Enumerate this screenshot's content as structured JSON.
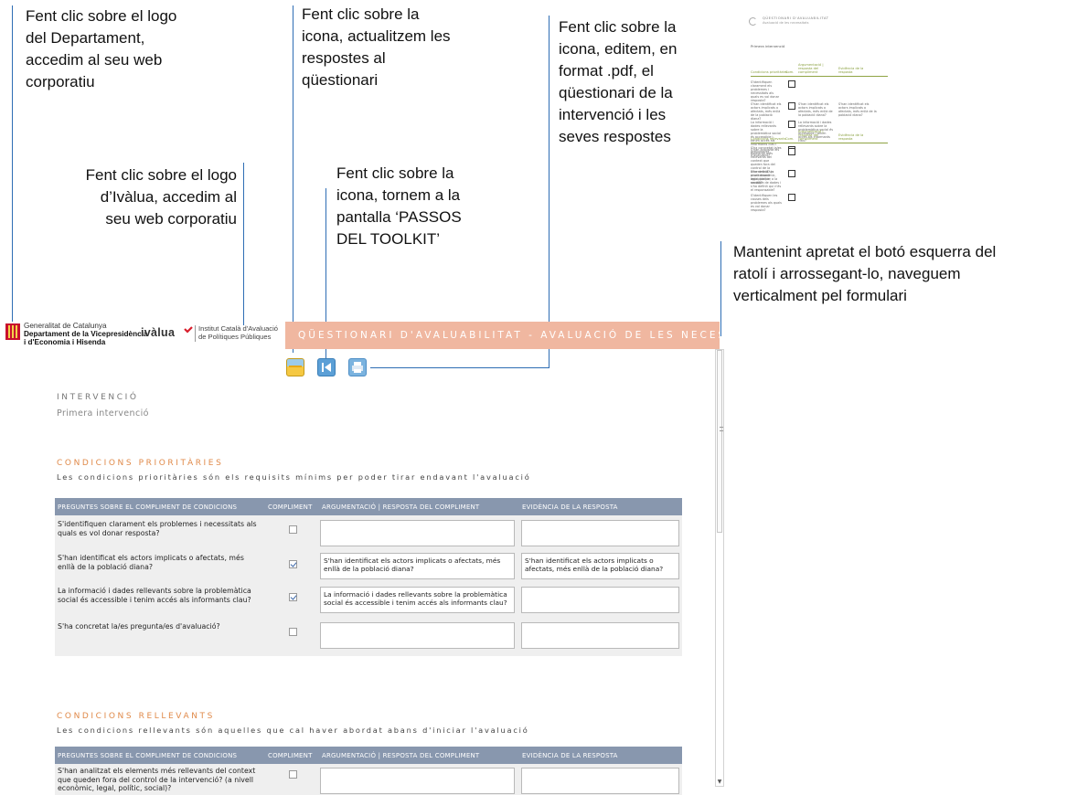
{
  "annotations": {
    "logo_departament": [
      "Fent clic sobre el logo",
      "del Departament,",
      "accedim al seu web",
      "corporatiu"
    ],
    "actualitzem": [
      "Fent clic sobre la",
      "icona, actualitzem les",
      "respostes al",
      "qüestionari"
    ],
    "editem": [
      "Fent clic sobre la",
      "icona, editem, en",
      "format .pdf, el",
      "qüestionari de la",
      "intervenció i les",
      "seves respostes"
    ],
    "logo_ivalua": [
      "Fent clic sobre el logo",
      "d’Ivàlua, accedim al",
      "seu web corporatiu"
    ],
    "tornem": [
      "Fent clic sobre la",
      "icona, tornem a la",
      "pantalla ‘PASSOS",
      "DEL TOOLKIT’"
    ],
    "scroll": [
      "Mantenint apretat el botó esquerra del",
      "ratolí i arrossegant-lo, naveguem",
      "verticalment pel formulari"
    ]
  },
  "thumbnail": {
    "title": "QÜESTIONARI D'AVALUABILITAT",
    "subtitle": "Avaluació de les necessitats",
    "intervention": "Primera intervenció",
    "h1": "Condicions prioritàries",
    "h_comp": "Com.",
    "h_arg": "Argumentació | resposta del compliment",
    "h_evid": "Evidència de la resposta",
    "h2": "Condicions rellevants",
    "rows1": [
      "S'identifiquen clarament els problemes i necessitats als quals es vol donar resposta?",
      "S'han identificat els actors implicats o afectats, més enllà de la població diana?",
      "La informació i dades rellevants sobre la problemàtica social és accessible i tenim accés als informants clau?",
      "S'ha concretat la/es pregunta/es d'avaluació?"
    ],
    "ans2": "S'han identificat els actors implicats o afectats, més enllà de la població diana?",
    "ans3": "La informació i dades rellevants sobre la problemàtica social és accessible i tenim accés als informants clau?",
    "rows2": [
      "S'han analitzat els elements més rellevants del context que queden fora del control de la intervenció? (a nivell econòmic, legal, polític, social)?",
      "S'ha definit un procediment aplicable per a la recollida de dades i s'ha definit qui n'és el responsable?",
      "S'identifiquen les causes dels problemes als quals es vol donar resposta?"
    ]
  },
  "header": {
    "generalitat_line1": "Generalitat de Catalunya",
    "generalitat_line2": "Departament de la Vicepresidència",
    "generalitat_line3": "i d'Economia i Hisenda",
    "ivalua": "ivàlua",
    "ivalua_inst_line1": "Institut Català d'Avaluació",
    "ivalua_inst_line2": "de Polítiques Públiques",
    "banner": "QÜESTIONARI D'AVALUABILITAT - AVALUACIÓ DE LES NECESSITATS"
  },
  "intervention": {
    "caption": "INTERVENCIÓ",
    "value": "Primera intervenció"
  },
  "table_headers": {
    "question": "PREGUNTES SOBRE EL COMPLIMENT DE CONDICIONS",
    "compliment": "COMPLIMENT",
    "argument": "ARGUMENTACIÓ | RESPOSTA DEL COMPLIMENT",
    "evidence": "EVIDÈNCIA DE LA RESPOSTA"
  },
  "prioritaries": {
    "title": "CONDICIONS PRIORITÀRIES",
    "desc": "Les condicions prioritàries són els requisits mínims per poder tirar endavant l'avaluació",
    "rows": [
      {
        "q": "S'identifiquen clarament els problemes i necessitats als quals es vol donar resposta?",
        "arg": "",
        "evid": ""
      },
      {
        "q": "S'han identificat els actors implicats o afectats, més enllà de la població diana?",
        "arg": "S'han identificat els actors implicats o afectats, més enllà de la població diana?",
        "evid": "S'han identificat els actors implicats o afectats, més enllà de la població diana?"
      },
      {
        "q": "La informació i dades rellevants sobre la problemàtica social és accessible i tenim accés als informants clau?",
        "arg": "La informació i dades rellevants sobre la problemàtica social és accessible i tenim accés als informants clau?",
        "evid": ""
      },
      {
        "q": "S'ha concretat la/es pregunta/es d'avaluació?",
        "arg": "",
        "evid": ""
      }
    ]
  },
  "rellevants": {
    "title": "CONDICIONS RELLEVANTS",
    "desc": "Les condicions rellevants són aquelles que cal haver abordat abans d'iniciar l'avaluació",
    "rows": [
      {
        "q": "S'han analitzat els elements més rellevants del context que queden fora del control de la intervenció? (a nivell econòmic, legal, polític, social)?",
        "arg": "",
        "evid": ""
      }
    ]
  }
}
